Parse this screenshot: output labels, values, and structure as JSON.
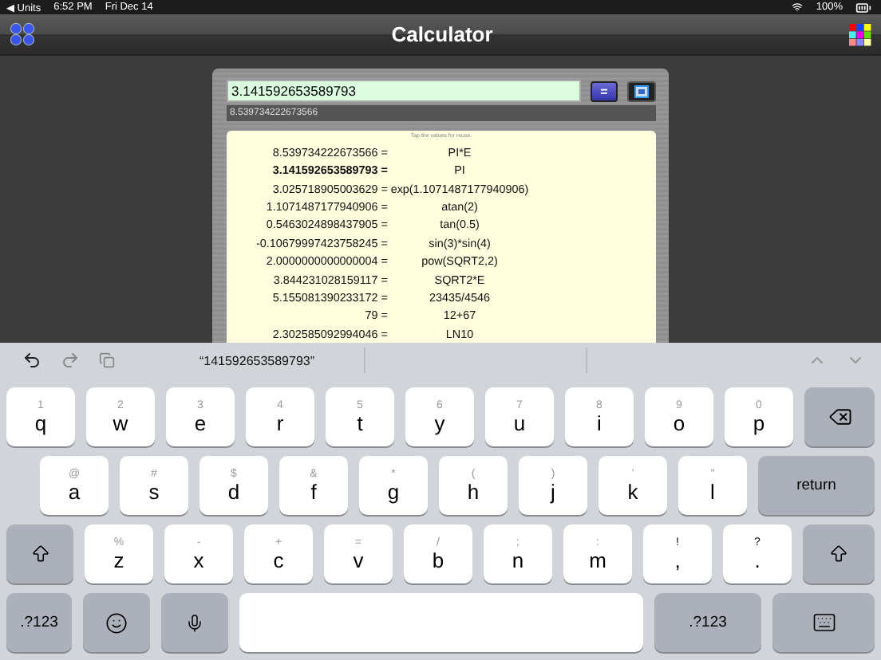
{
  "status_bar": {
    "back": "◀ Units",
    "time": "6:52 PM",
    "date": "Fri Dec 14",
    "battery": "100%"
  },
  "nav": {
    "title": "Calculator"
  },
  "calculator": {
    "input": "3.141592653589793",
    "equals": "=",
    "result": "8.539734222673566",
    "hint": "Tap the values for reuse.",
    "history": [
      {
        "value": "8.539734222673566 =",
        "expression": "PI*E",
        "selected": false
      },
      {
        "value": "3.141592653589793 =",
        "expression": "PI",
        "selected": true
      },
      {
        "value": "3.025718905003629 =",
        "expression": "exp(1.1071487177940906)",
        "selected": false
      },
      {
        "value": "1.1071487177940906 =",
        "expression": "atan(2)",
        "selected": false
      },
      {
        "value": "0.5463024898437905 =",
        "expression": "tan(0.5)",
        "selected": false
      },
      {
        "value": "-0.10679997423758245 =",
        "expression": "sin(3)*sin(4)",
        "selected": false
      },
      {
        "value": "2.0000000000000004 =",
        "expression": "pow(SQRT2,2)",
        "selected": false
      },
      {
        "value": "3.844231028159117 =",
        "expression": "SQRT2*E",
        "selected": false
      },
      {
        "value": "5.155081390233172 =",
        "expression": "23435/4546",
        "selected": false
      },
      {
        "value": "79 =",
        "expression": "12+67",
        "selected": false
      },
      {
        "value": "2.302585092994046 =",
        "expression": "LN10",
        "selected": false
      }
    ]
  },
  "keyboard": {
    "suggestion": "“141592653589793”",
    "rows": [
      {
        "keys": [
          {
            "kind": "letter",
            "label": "q",
            "hint": "1"
          },
          {
            "kind": "letter",
            "label": "w",
            "hint": "2"
          },
          {
            "kind": "letter",
            "label": "e",
            "hint": "3"
          },
          {
            "kind": "letter",
            "label": "r",
            "hint": "4"
          },
          {
            "kind": "letter",
            "label": "t",
            "hint": "5"
          },
          {
            "kind": "letter",
            "label": "y",
            "hint": "6"
          },
          {
            "kind": "letter",
            "label": "u",
            "hint": "7"
          },
          {
            "kind": "letter",
            "label": "i",
            "hint": "8"
          },
          {
            "kind": "letter",
            "label": "o",
            "hint": "9"
          },
          {
            "kind": "letter",
            "label": "p",
            "hint": "0"
          },
          {
            "kind": "delete"
          }
        ]
      },
      {
        "keys": [
          {
            "kind": "letter",
            "label": "a",
            "hint": "@"
          },
          {
            "kind": "letter",
            "label": "s",
            "hint": "#"
          },
          {
            "kind": "letter",
            "label": "d",
            "hint": "$"
          },
          {
            "kind": "letter",
            "label": "f",
            "hint": "&"
          },
          {
            "kind": "letter",
            "label": "g",
            "hint": "*"
          },
          {
            "kind": "letter",
            "label": "h",
            "hint": "("
          },
          {
            "kind": "letter",
            "label": "j",
            "hint": ")"
          },
          {
            "kind": "letter",
            "label": "k",
            "hint": "’"
          },
          {
            "kind": "letter",
            "label": "l",
            "hint": "\""
          },
          {
            "kind": "return",
            "label": "return"
          }
        ]
      },
      {
        "keys": [
          {
            "kind": "shift"
          },
          {
            "kind": "letter",
            "label": "z",
            "hint": "%"
          },
          {
            "kind": "letter",
            "label": "x",
            "hint": "-"
          },
          {
            "kind": "letter",
            "label": "c",
            "hint": "+"
          },
          {
            "kind": "letter",
            "label": "v",
            "hint": "="
          },
          {
            "kind": "letter",
            "label": "b",
            "hint": "/"
          },
          {
            "kind": "letter",
            "label": "n",
            "hint": ";"
          },
          {
            "kind": "letter",
            "label": "m",
            "hint": ":"
          },
          {
            "kind": "punct",
            "label": ",",
            "hint": "!"
          },
          {
            "kind": "punct",
            "label": ".",
            "hint": "?"
          },
          {
            "kind": "shift"
          }
        ]
      },
      {
        "keys": [
          {
            "kind": "mode",
            "label": ".?123"
          },
          {
            "kind": "emoji"
          },
          {
            "kind": "mic"
          },
          {
            "kind": "space"
          },
          {
            "kind": "mode",
            "label": ".?123"
          },
          {
            "kind": "hide"
          }
        ]
      }
    ]
  }
}
